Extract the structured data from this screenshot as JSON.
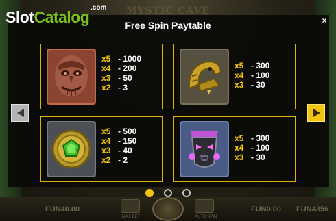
{
  "brand": {
    "name_part1": "Slot",
    "name_part2": "Catalog",
    "suffix": ".com"
  },
  "background_title": "MYSTIC CAVE",
  "dialog": {
    "title": "Free Spin Paytable",
    "close_glyph": "×"
  },
  "symbols": [
    {
      "icon": "red-stone-mask-icon",
      "payouts": [
        {
          "mult": "x5",
          "value": "- 1000"
        },
        {
          "mult": "x4",
          "value": "- 200"
        },
        {
          "mult": "x3",
          "value": "- 50"
        },
        {
          "mult": "x2",
          "value": "- 3"
        }
      ]
    },
    {
      "icon": "gold-serpent-head-icon",
      "payouts": [
        {
          "mult": "x5",
          "value": "- 300"
        },
        {
          "mult": "x4",
          "value": "- 100"
        },
        {
          "mult": "x3",
          "value": "- 30"
        }
      ]
    },
    {
      "icon": "green-gem-medallion-icon",
      "payouts": [
        {
          "mult": "x5",
          "value": "- 500"
        },
        {
          "mult": "x4",
          "value": "- 150"
        },
        {
          "mult": "x3",
          "value": "- 40"
        },
        {
          "mult": "x2",
          "value": "- 2"
        }
      ]
    },
    {
      "icon": "purple-tribal-mask-icon",
      "payouts": [
        {
          "mult": "x5",
          "value": "- 300"
        },
        {
          "mult": "x4",
          "value": "- 100"
        },
        {
          "mult": "x3",
          "value": "- 30"
        }
      ]
    }
  ],
  "pagination": {
    "pages": 3,
    "active": 1
  },
  "bottom_bar": {
    "bet": "FUN40.00",
    "max_bet_label": "MAX BET",
    "auto_spin_label": "AUTO SPIN",
    "win": "FUN0.00",
    "balance": "FUN4356"
  },
  "colors": {
    "accent": "#f1c40f",
    "card_border": "#d9b20a",
    "brand_green": "#7ac11e"
  }
}
